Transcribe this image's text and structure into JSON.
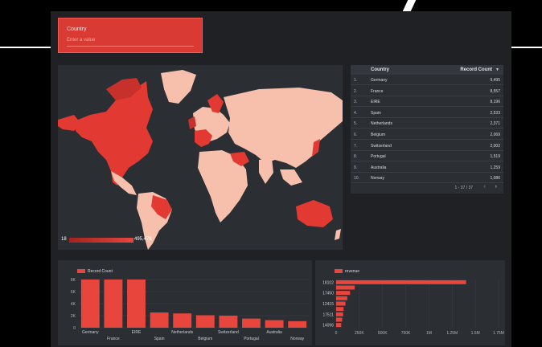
{
  "filter": {
    "label": "Country",
    "placeholder": "Enter a value"
  },
  "map": {
    "legend_min": "18",
    "legend_max": "495,478",
    "colors": {
      "land": "#f6c0ad",
      "high": "#e23a32",
      "mid": "#c8302b",
      "water": "#2b2e33"
    }
  },
  "table": {
    "headers": {
      "country": "Country",
      "count": "Record Count",
      "sort_icon": "▼"
    },
    "rows": [
      {
        "idx": "1.",
        "country": "Germany",
        "count": "9,495"
      },
      {
        "idx": "2.",
        "country": "France",
        "count": "8,557"
      },
      {
        "idx": "3.",
        "country": "EIRE",
        "count": "8,196"
      },
      {
        "idx": "4.",
        "country": "Spain",
        "count": "2,533"
      },
      {
        "idx": "5.",
        "country": "Netherlands",
        "count": "2,371"
      },
      {
        "idx": "6.",
        "country": "Belgium",
        "count": "2,069"
      },
      {
        "idx": "7.",
        "country": "Switzerland",
        "count": "2,002"
      },
      {
        "idx": "8.",
        "country": "Portugal",
        "count": "1,519"
      },
      {
        "idx": "9.",
        "country": "Australia",
        "count": "1,259"
      },
      {
        "idx": "10.",
        "country": "Norway",
        "count": "1,086"
      }
    ],
    "pager": "1 - 37 / 37",
    "prev": "‹",
    "next": "›"
  },
  "chart_data": [
    {
      "type": "bar",
      "legend": "Record Count",
      "categories": [
        "Germany",
        "France",
        "EIRE",
        "Spain",
        "Netherlands",
        "Belgium",
        "Switzerland",
        "Portugal",
        "Australia",
        "Norway"
      ],
      "values": [
        9495,
        8557,
        8196,
        2533,
        2371,
        2069,
        2002,
        1519,
        1259,
        1086
      ],
      "yticks": [
        "8K",
        "6K",
        "4K",
        "2K",
        "0"
      ],
      "ylim": [
        0,
        8000
      ],
      "color": "#e8463d"
    },
    {
      "type": "bar",
      "orientation": "horizontal",
      "legend": "revenue",
      "categories": [
        "18102",
        "",
        "17450",
        "",
        "12415",
        "",
        "17511",
        "",
        "14096"
      ],
      "values": [
        1400000,
        200000,
        150000,
        120000,
        100000,
        80000,
        75000,
        65000,
        55000
      ],
      "xticks": [
        "0",
        "250K",
        "500K",
        "750K",
        "1M",
        "1.25M",
        "1.5M",
        "1.75M"
      ],
      "xlim": [
        0,
        1750000
      ],
      "color": "#e8463d"
    }
  ]
}
